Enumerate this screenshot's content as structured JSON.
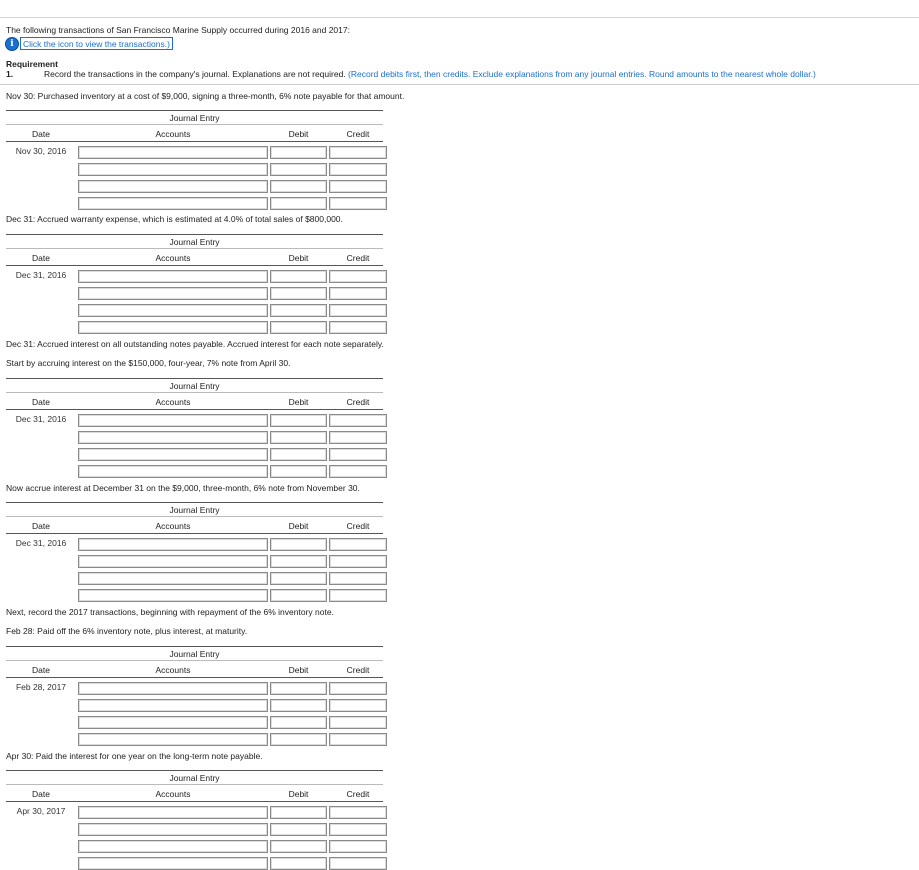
{
  "intro": {
    "text": "The following transactions of San Francisco Marine Supply occurred during 2016 and 2017:",
    "icon": "info-icon",
    "icon_link": "Click the icon to view the transactions.)"
  },
  "requirement": {
    "title": "Requirement",
    "number": "1.",
    "text": "Record the transactions in the company's journal. Explanations are not required.",
    "note": "(Record debits first, then credits. Exclude explanations from any journal entries. Round amounts to the nearest whole dollar.)"
  },
  "table_labels": {
    "title": "Journal Entry",
    "date": "Date",
    "accounts": "Accounts",
    "debit": "Debit",
    "credit": "Credit"
  },
  "entries": [
    {
      "prompts": [
        "Nov 30: Purchased inventory at a cost of $9,000, signing a three-month, 6% note payable for that amount."
      ],
      "date": "Nov 30, 2016"
    },
    {
      "prompts": [
        "Dec 31: Accrued warranty expense, which is estimated at 4.0% of total sales of $800,000."
      ],
      "date": "Dec 31, 2016"
    },
    {
      "prompts": [
        "Dec 31: Accrued interest on all outstanding notes payable. Accrued interest for each note separately.",
        "Start by accruing interest on the $150,000, four-year, 7% note from April 30."
      ],
      "date": "Dec 31, 2016"
    },
    {
      "prompts": [
        "Now accrue interest at December 31 on the $9,000, three-month, 6% note from November 30."
      ],
      "date": "Dec 31, 2016"
    },
    {
      "prompts": [
        "Next, record the 2017 transactions, beginning with repayment of the 6% inventory note.",
        "Feb 28: Paid off the 6% inventory note, plus interest, at maturity."
      ],
      "date": "Feb 28, 2017"
    },
    {
      "prompts": [
        "Apr 30: Paid the interest for one year on the long-term note payable."
      ],
      "date": "Apr 30, 2017"
    }
  ]
}
